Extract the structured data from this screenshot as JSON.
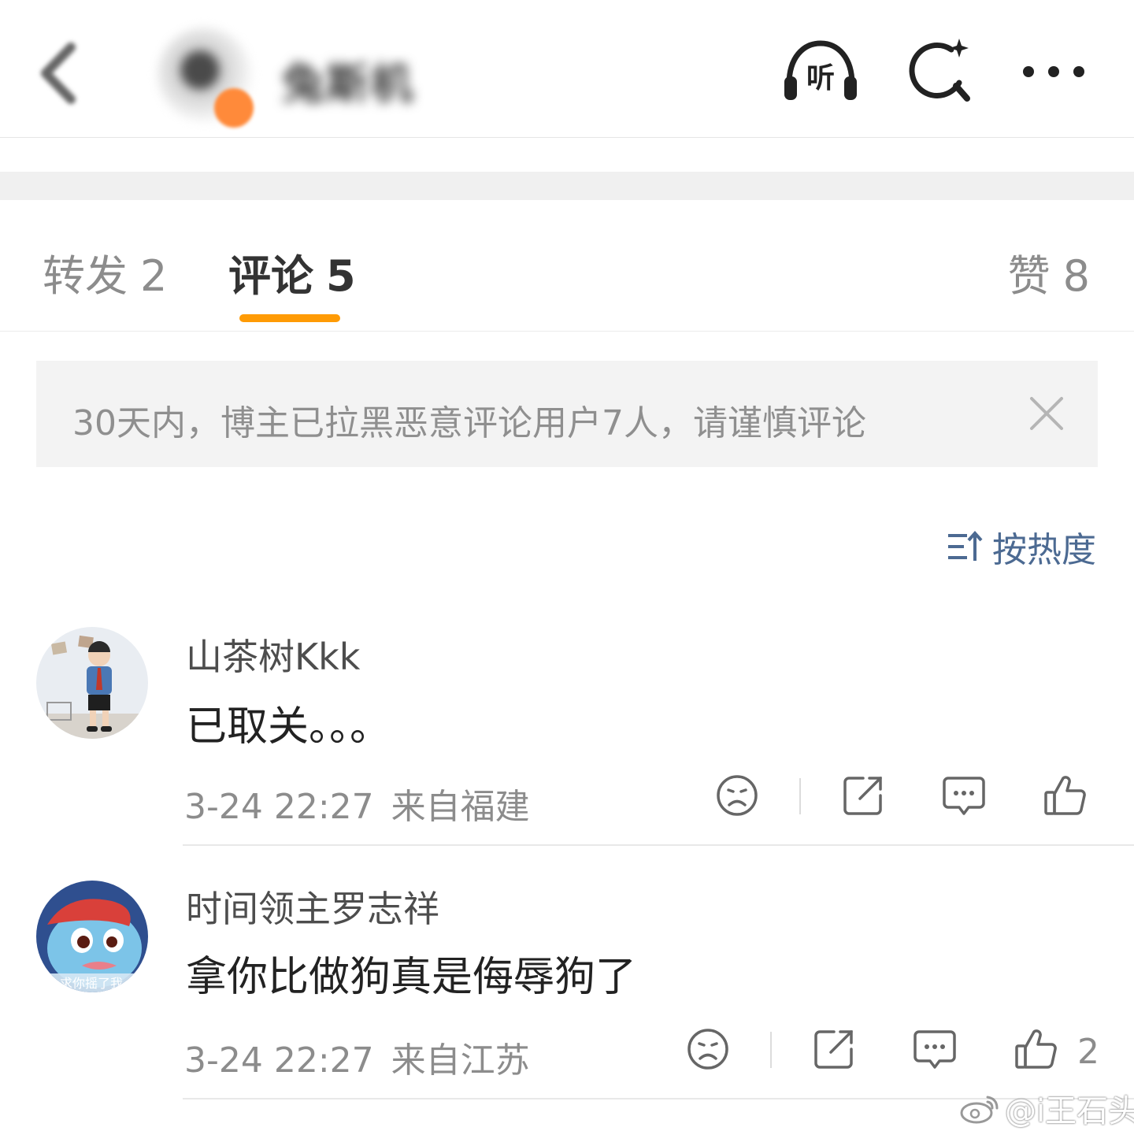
{
  "header": {
    "author_name": "兔斯机",
    "icons": [
      "back-icon",
      "listen-icon",
      "ai-search-icon",
      "more-icon"
    ]
  },
  "tabs": [
    {
      "label": "转发",
      "count": "2"
    },
    {
      "label": "评论",
      "count": "5",
      "active": true
    },
    {
      "label": "赞",
      "count": "8"
    }
  ],
  "notice": {
    "text": "30天内，博主已拉黑恶意评论用户7人，请谨慎评论"
  },
  "sort": {
    "label": "按热度"
  },
  "comments": [
    {
      "user": "山茶树Kkk",
      "text": "已取关。。。",
      "time": "3-24 22:27",
      "location": "来自福建",
      "likes": ""
    },
    {
      "user": "时间领主罗志祥",
      "text": "拿你比做狗真是侮辱狗了",
      "time": "3-24 22:27",
      "location": "来自江苏",
      "likes": "2"
    }
  ],
  "watermark": {
    "text": "@i王石头"
  },
  "colors": {
    "accent": "#ff9b05",
    "link": "#4c6a92",
    "muted": "#8c8c8c",
    "text": "#222222"
  }
}
